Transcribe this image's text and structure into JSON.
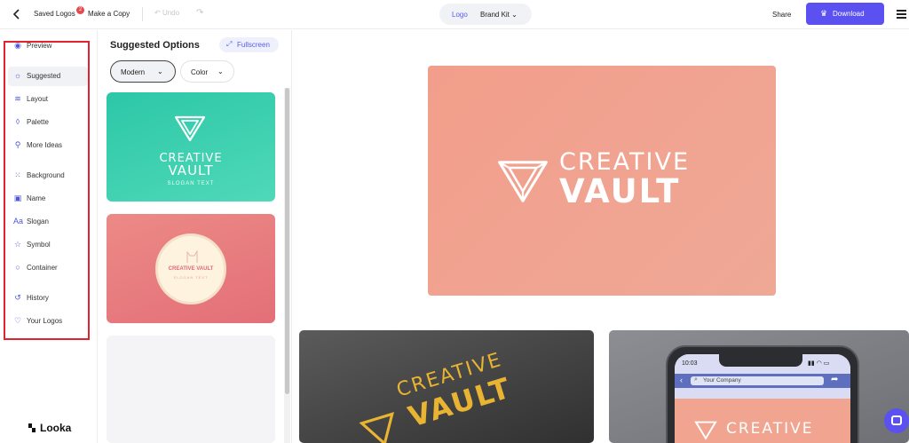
{
  "topbar": {
    "back_icon": "chevron-left-icon",
    "saved_logos": "Saved Logos",
    "saved_badge": "2",
    "make_copy": "Make a Copy",
    "undo": "Undo",
    "redo_icon": "redo-icon",
    "switcher": {
      "logo": "Logo",
      "brand_kit": "Brand Kit"
    },
    "share": "Share",
    "download": "Download",
    "menu_icon": "hamburger-icon"
  },
  "sidebar": {
    "items": [
      {
        "label": "Preview",
        "icon": "eye-icon"
      },
      {
        "label": "Suggested",
        "icon": "bulb-icon"
      },
      {
        "label": "Layout",
        "icon": "layers-icon"
      },
      {
        "label": "Palette",
        "icon": "drop-icon"
      },
      {
        "label": "More Ideas",
        "icon": "magic-wand-icon"
      },
      {
        "label": "Background",
        "icon": "grid-icon"
      },
      {
        "label": "Name",
        "icon": "text-box-icon"
      },
      {
        "label": "Slogan",
        "icon": "text-size-icon"
      },
      {
        "label": "Symbol",
        "icon": "star-icon"
      },
      {
        "label": "Container",
        "icon": "circle-icon"
      },
      {
        "label": "History",
        "icon": "history-icon"
      },
      {
        "label": "Your Logos",
        "icon": "heart-icon"
      }
    ],
    "brand": "Looka",
    "highlight_color": "#e0232e"
  },
  "panel": {
    "title": "Suggested Options",
    "fullscreen": "Fullscreen",
    "filters": [
      {
        "label": "Modern",
        "selected": true
      },
      {
        "label": "Color",
        "selected": false
      }
    ],
    "cards": [
      {
        "name": "CREATIVE",
        "name2": "VAULT",
        "slogan": "SLOGAN TEXT",
        "bg": "#2cc7a7"
      },
      {
        "name": "CREATIVE VAULT",
        "slogan": "SLOGAN TEXT",
        "bg": "#e36f78"
      }
    ]
  },
  "preview": {
    "name_line1": "CREATIVE",
    "name_line2": "VAULT",
    "hero_bg": "#f29e8b",
    "phone_time": "10:03",
    "phone_search": "Your Company",
    "phone_logo_text": "CREATIVE"
  },
  "colors": {
    "accent": "#5a51f0"
  }
}
